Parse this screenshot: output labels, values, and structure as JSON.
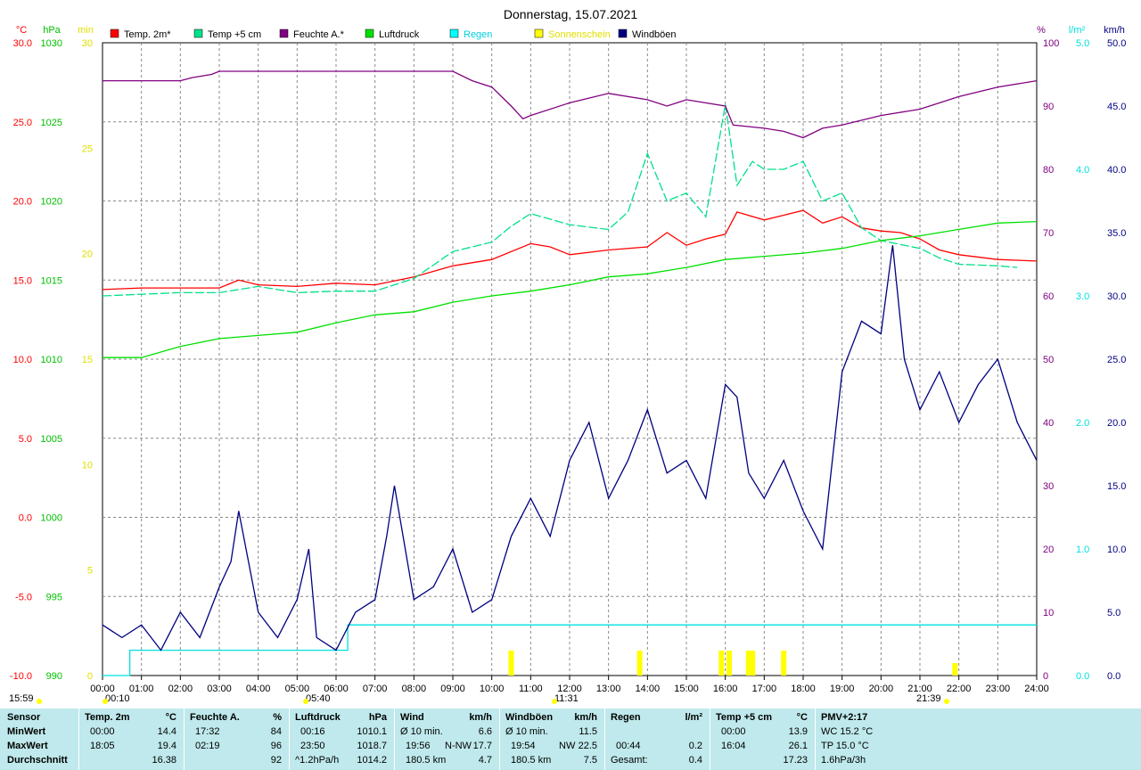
{
  "chart_data": {
    "type": "line",
    "title": "Donnerstag, 15.07.2021",
    "x_ticks": [
      "00:00",
      "01:00",
      "02:00",
      "03:00",
      "04:00",
      "05:00",
      "06:00",
      "07:00",
      "08:00",
      "09:00",
      "10:00",
      "11:00",
      "12:00",
      "13:00",
      "14:00",
      "15:00",
      "16:00",
      "17:00",
      "18:00",
      "19:00",
      "20:00",
      "21:00",
      "22:00",
      "23:00",
      "24:00"
    ],
    "xlim": [
      0,
      24
    ],
    "axes": {
      "temp": {
        "label": "°C",
        "color": "#ff0000",
        "range": [
          -10,
          30
        ],
        "ticks": [
          "-10.0",
          "-5.0",
          "0.0",
          "5.0",
          "10.0",
          "15.0",
          "20.0",
          "25.0",
          "30.0"
        ]
      },
      "pressure": {
        "label": "hPa",
        "color": "#00c000",
        "range": [
          990,
          1030
        ],
        "ticks": [
          "990",
          "995",
          "1000",
          "1005",
          "1010",
          "1015",
          "1020",
          "1025",
          "1030"
        ]
      },
      "sun": {
        "label": "min",
        "color": "#ffff00",
        "range": [
          0,
          30
        ],
        "ticks": [
          "0",
          "5",
          "10",
          "15",
          "20",
          "25",
          "30"
        ]
      },
      "humidity": {
        "label": "%",
        "color": "#800080",
        "range": [
          0,
          100
        ],
        "ticks": [
          "0",
          "10",
          "20",
          "30",
          "40",
          "50",
          "60",
          "70",
          "80",
          "90",
          "100"
        ]
      },
      "rain": {
        "label": "l/m²",
        "color": "#00e0e0",
        "range": [
          0,
          5
        ],
        "ticks": [
          "0.0",
          "1.0",
          "2.0",
          "3.0",
          "4.0",
          "5.0"
        ]
      },
      "wind": {
        "label": "km/h",
        "color": "#000080",
        "range": [
          0,
          50
        ],
        "ticks": [
          "0.0",
          "5.0",
          "10.0",
          "15.0",
          "20.0",
          "25.0",
          "30.0",
          "35.0",
          "40.0",
          "45.0",
          "50.0"
        ]
      }
    },
    "legend": [
      {
        "name": "Temp. 2m*",
        "color": "#ff0000"
      },
      {
        "name": "Temp +5 cm",
        "color": "#00e08a"
      },
      {
        "name": "Feuchte A.*",
        "color": "#800080"
      },
      {
        "name": "Luftdruck",
        "color": "#00e000"
      },
      {
        "name": "Regen",
        "color": "#00ffff"
      },
      {
        "name": "Sonnenschein",
        "color": "#ffff00"
      },
      {
        "name": "Windböen",
        "color": "#000080"
      }
    ],
    "series": [
      {
        "name": "Temp. 2m*",
        "axis": "temp",
        "color": "#ff0000",
        "x": [
          0,
          1,
          2,
          3,
          3.5,
          4,
          5,
          6,
          7,
          8,
          9,
          10,
          11,
          11.5,
          12,
          13,
          14,
          14.5,
          15,
          15.5,
          16,
          16.3,
          17,
          17.5,
          18,
          18.5,
          19,
          19.5,
          20,
          20.5,
          21,
          21.5,
          22,
          23,
          24
        ],
        "y": [
          14.4,
          14.5,
          14.5,
          14.5,
          15,
          14.7,
          14.6,
          14.8,
          14.7,
          15.2,
          15.9,
          16.3,
          17.3,
          17.1,
          16.6,
          16.9,
          17.1,
          18.0,
          17.2,
          17.6,
          17.9,
          19.3,
          18.8,
          19.1,
          19.4,
          18.6,
          19.0,
          18.3,
          18.1,
          18.0,
          17.6,
          16.9,
          16.6,
          16.3,
          16.2
        ]
      },
      {
        "name": "Temp +5 cm",
        "axis": "temp",
        "color": "#00e08a",
        "x": [
          0,
          1,
          2,
          3,
          4,
          5,
          6,
          7,
          8,
          9,
          10,
          10.5,
          11,
          12,
          13,
          13.5,
          14,
          14.5,
          15,
          15.5,
          16,
          16.3,
          16.7,
          17,
          17.5,
          18,
          18.5,
          19,
          19.5,
          20,
          21,
          21.5,
          22,
          23,
          23.5
        ],
        "y": [
          14.0,
          14.1,
          14.2,
          14.2,
          14.6,
          14.2,
          14.3,
          14.3,
          15.1,
          16.8,
          17.4,
          18.4,
          19.2,
          18.5,
          18.2,
          19.3,
          23.0,
          20.0,
          20.5,
          19.0,
          26.1,
          21.0,
          22.5,
          22.0,
          22.0,
          22.5,
          20.0,
          20.5,
          18.3,
          17.5,
          17.0,
          16.4,
          16.0,
          15.9,
          15.8
        ]
      },
      {
        "name": "Feuchte A.*",
        "axis": "humidity",
        "color": "#800080",
        "x": [
          0,
          2,
          2.3,
          2.8,
          3,
          4,
          5,
          6,
          7,
          8,
          9,
          9.5,
          10,
          10.5,
          10.8,
          11,
          12,
          13,
          14,
          14.5,
          15,
          16,
          16.2,
          17,
          17.5,
          18,
          18.5,
          19,
          20,
          21,
          22,
          23,
          24
        ],
        "y": [
          94,
          94,
          94.5,
          95,
          95.5,
          95.5,
          95.5,
          95.5,
          95.5,
          95.5,
          95.5,
          94,
          93,
          90,
          88,
          88.5,
          90.5,
          92,
          91,
          90,
          91,
          90,
          87,
          86.5,
          86,
          85,
          86.5,
          87,
          88.5,
          89.5,
          91.5,
          93,
          94
        ]
      },
      {
        "name": "Luftdruck",
        "axis": "pressure",
        "color": "#00e000",
        "x": [
          0,
          1,
          2,
          3,
          4,
          5,
          6,
          7,
          8,
          9,
          10,
          11,
          12,
          13,
          14,
          15,
          16,
          17,
          18,
          19,
          20,
          21,
          22,
          23,
          24
        ],
        "y": [
          1010.1,
          1010.1,
          1010.8,
          1011.3,
          1011.5,
          1011.7,
          1012.3,
          1012.8,
          1013.0,
          1013.6,
          1014.0,
          1014.3,
          1014.7,
          1015.2,
          1015.4,
          1015.8,
          1016.3,
          1016.5,
          1016.7,
          1017.0,
          1017.5,
          1017.8,
          1018.2,
          1018.6,
          1018.7
        ]
      },
      {
        "name": "Regen",
        "axis": "rain",
        "color": "#00e0e0",
        "x": [
          0,
          0.7,
          0.7,
          6.3,
          6.3,
          24
        ],
        "y": [
          0,
          0,
          0.2,
          0.2,
          0.4,
          0.4
        ]
      },
      {
        "name": "Windböen",
        "axis": "wind",
        "color": "#000080",
        "x": [
          0,
          0.5,
          1,
          1.5,
          2,
          2.5,
          3,
          3.3,
          3.5,
          4,
          4.5,
          5,
          5.3,
          5.5,
          6,
          6.5,
          7,
          7.3,
          7.5,
          8,
          8.5,
          9,
          9.5,
          10,
          10.5,
          11,
          11.5,
          12,
          12.5,
          13,
          13.5,
          14,
          14.5,
          15,
          15.5,
          16,
          16.3,
          16.6,
          17,
          17.5,
          18,
          18.5,
          19,
          19.5,
          20,
          20.3,
          20.6,
          21,
          21.5,
          22,
          22.5,
          23,
          23.5,
          24
        ],
        "y": [
          4,
          3,
          4,
          2,
          5,
          3,
          7,
          9,
          13,
          5,
          3,
          6,
          10,
          3,
          2,
          5,
          6,
          11,
          15,
          6,
          7,
          10,
          5,
          6,
          11,
          14,
          11,
          17,
          20,
          14,
          17,
          21,
          16,
          17,
          14,
          23,
          22,
          16,
          14,
          17,
          13,
          10,
          24,
          28,
          27,
          34,
          25,
          21,
          24,
          20,
          23,
          25,
          20,
          17
        ]
      },
      {
        "name": "Sonnenschein",
        "axis": "sun",
        "color": "#ffff00",
        "x": [
          10.5,
          13.8,
          15.9,
          16.1,
          16.6,
          16.7,
          17.5,
          21.9
        ],
        "y": [
          1,
          1,
          1,
          1,
          1,
          1,
          1,
          0.5
        ]
      }
    ],
    "markers": [
      {
        "label": "00:10"
      },
      {
        "label": "05:40"
      },
      {
        "label": "11:31"
      },
      {
        "label": "15:59"
      },
      {
        "label": "21:39"
      }
    ]
  },
  "stats": {
    "sensor": {
      "title": "Sensor",
      "rows": [
        "MinWert",
        "MaxWert",
        "Durchschnitt"
      ]
    },
    "temp2m": {
      "title": "Temp. 2m",
      "unit": "°C",
      "min_time": "00:00",
      "min": "14.4",
      "max_time": "18:05",
      "max": "19.4",
      "avg": "16.38"
    },
    "feuchte": {
      "title": "Feuchte A.",
      "unit": "%",
      "min_time": "17:32",
      "min": "84",
      "max_time": "02:19",
      "max": "96",
      "avg": "92"
    },
    "luftdruck": {
      "title": "Luftdruck",
      "unit": "hPa",
      "min_time": "00:16",
      "min": "1010.1",
      "max_time": "23:50",
      "max": "1018.7",
      "trend": "^1.2hPa/h",
      "avg": "1014.2"
    },
    "wind": {
      "title": "Wind",
      "unit": "km/h",
      "label10": "Ø 10 min.",
      "val10": "6.6",
      "max_time": "19:56",
      "max_dir": "N-NW",
      "max": "17.7",
      "dist": "180.5 km",
      "avg": "4.7"
    },
    "windboeen": {
      "title": "Windböen",
      "unit": "km/h",
      "label10": "Ø 10 min.",
      "val10": "11.5",
      "max_time": "19:54",
      "max_dir": "NW",
      "max": "22.5",
      "dist": "180.5 km",
      "avg": "7.5"
    },
    "regen": {
      "title": "Regen",
      "unit": "l/m²",
      "max_time": "00:44",
      "max": "0.2",
      "total_label": "Gesamt:",
      "total": "0.4"
    },
    "temp5cm": {
      "title": "Temp +5 cm",
      "unit": "°C",
      "min_time": "00:00",
      "min": "13.9",
      "max_time": "16:04",
      "max": "26.1",
      "avg": "17.23"
    },
    "pmv": {
      "title": "PMV+2:17",
      "wc": "WC 15.2 °C",
      "tp": "TP 15.0 °C",
      "trend": "1.6hPa/3h"
    }
  }
}
